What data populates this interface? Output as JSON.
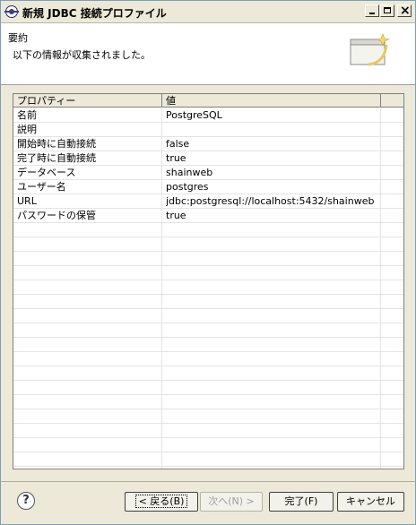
{
  "window": {
    "title": "新規 JDBC 接続プロファイル"
  },
  "header": {
    "title": "要約",
    "description": "以下の情報が収集されました。"
  },
  "table": {
    "columns": [
      "プロパティー",
      "値"
    ],
    "rows": [
      {
        "property": "名前",
        "value": "PostgreSQL"
      },
      {
        "property": "説明",
        "value": ""
      },
      {
        "property": "開始時に自動接続",
        "value": "false"
      },
      {
        "property": "完了時に自動接続",
        "value": "true"
      },
      {
        "property": "データベース",
        "value": "shainweb"
      },
      {
        "property": "ユーザー名",
        "value": "postgres"
      },
      {
        "property": "URL",
        "value": "jdbc:postgresql://localhost:5432/shainweb"
      },
      {
        "property": "パスワードの保管",
        "value": "true"
      }
    ]
  },
  "buttons": {
    "back": "< 戻る(B)",
    "next": "次へ(N) >",
    "finish": "完了(F)",
    "cancel": "キャンセル"
  },
  "help_icon": "?"
}
